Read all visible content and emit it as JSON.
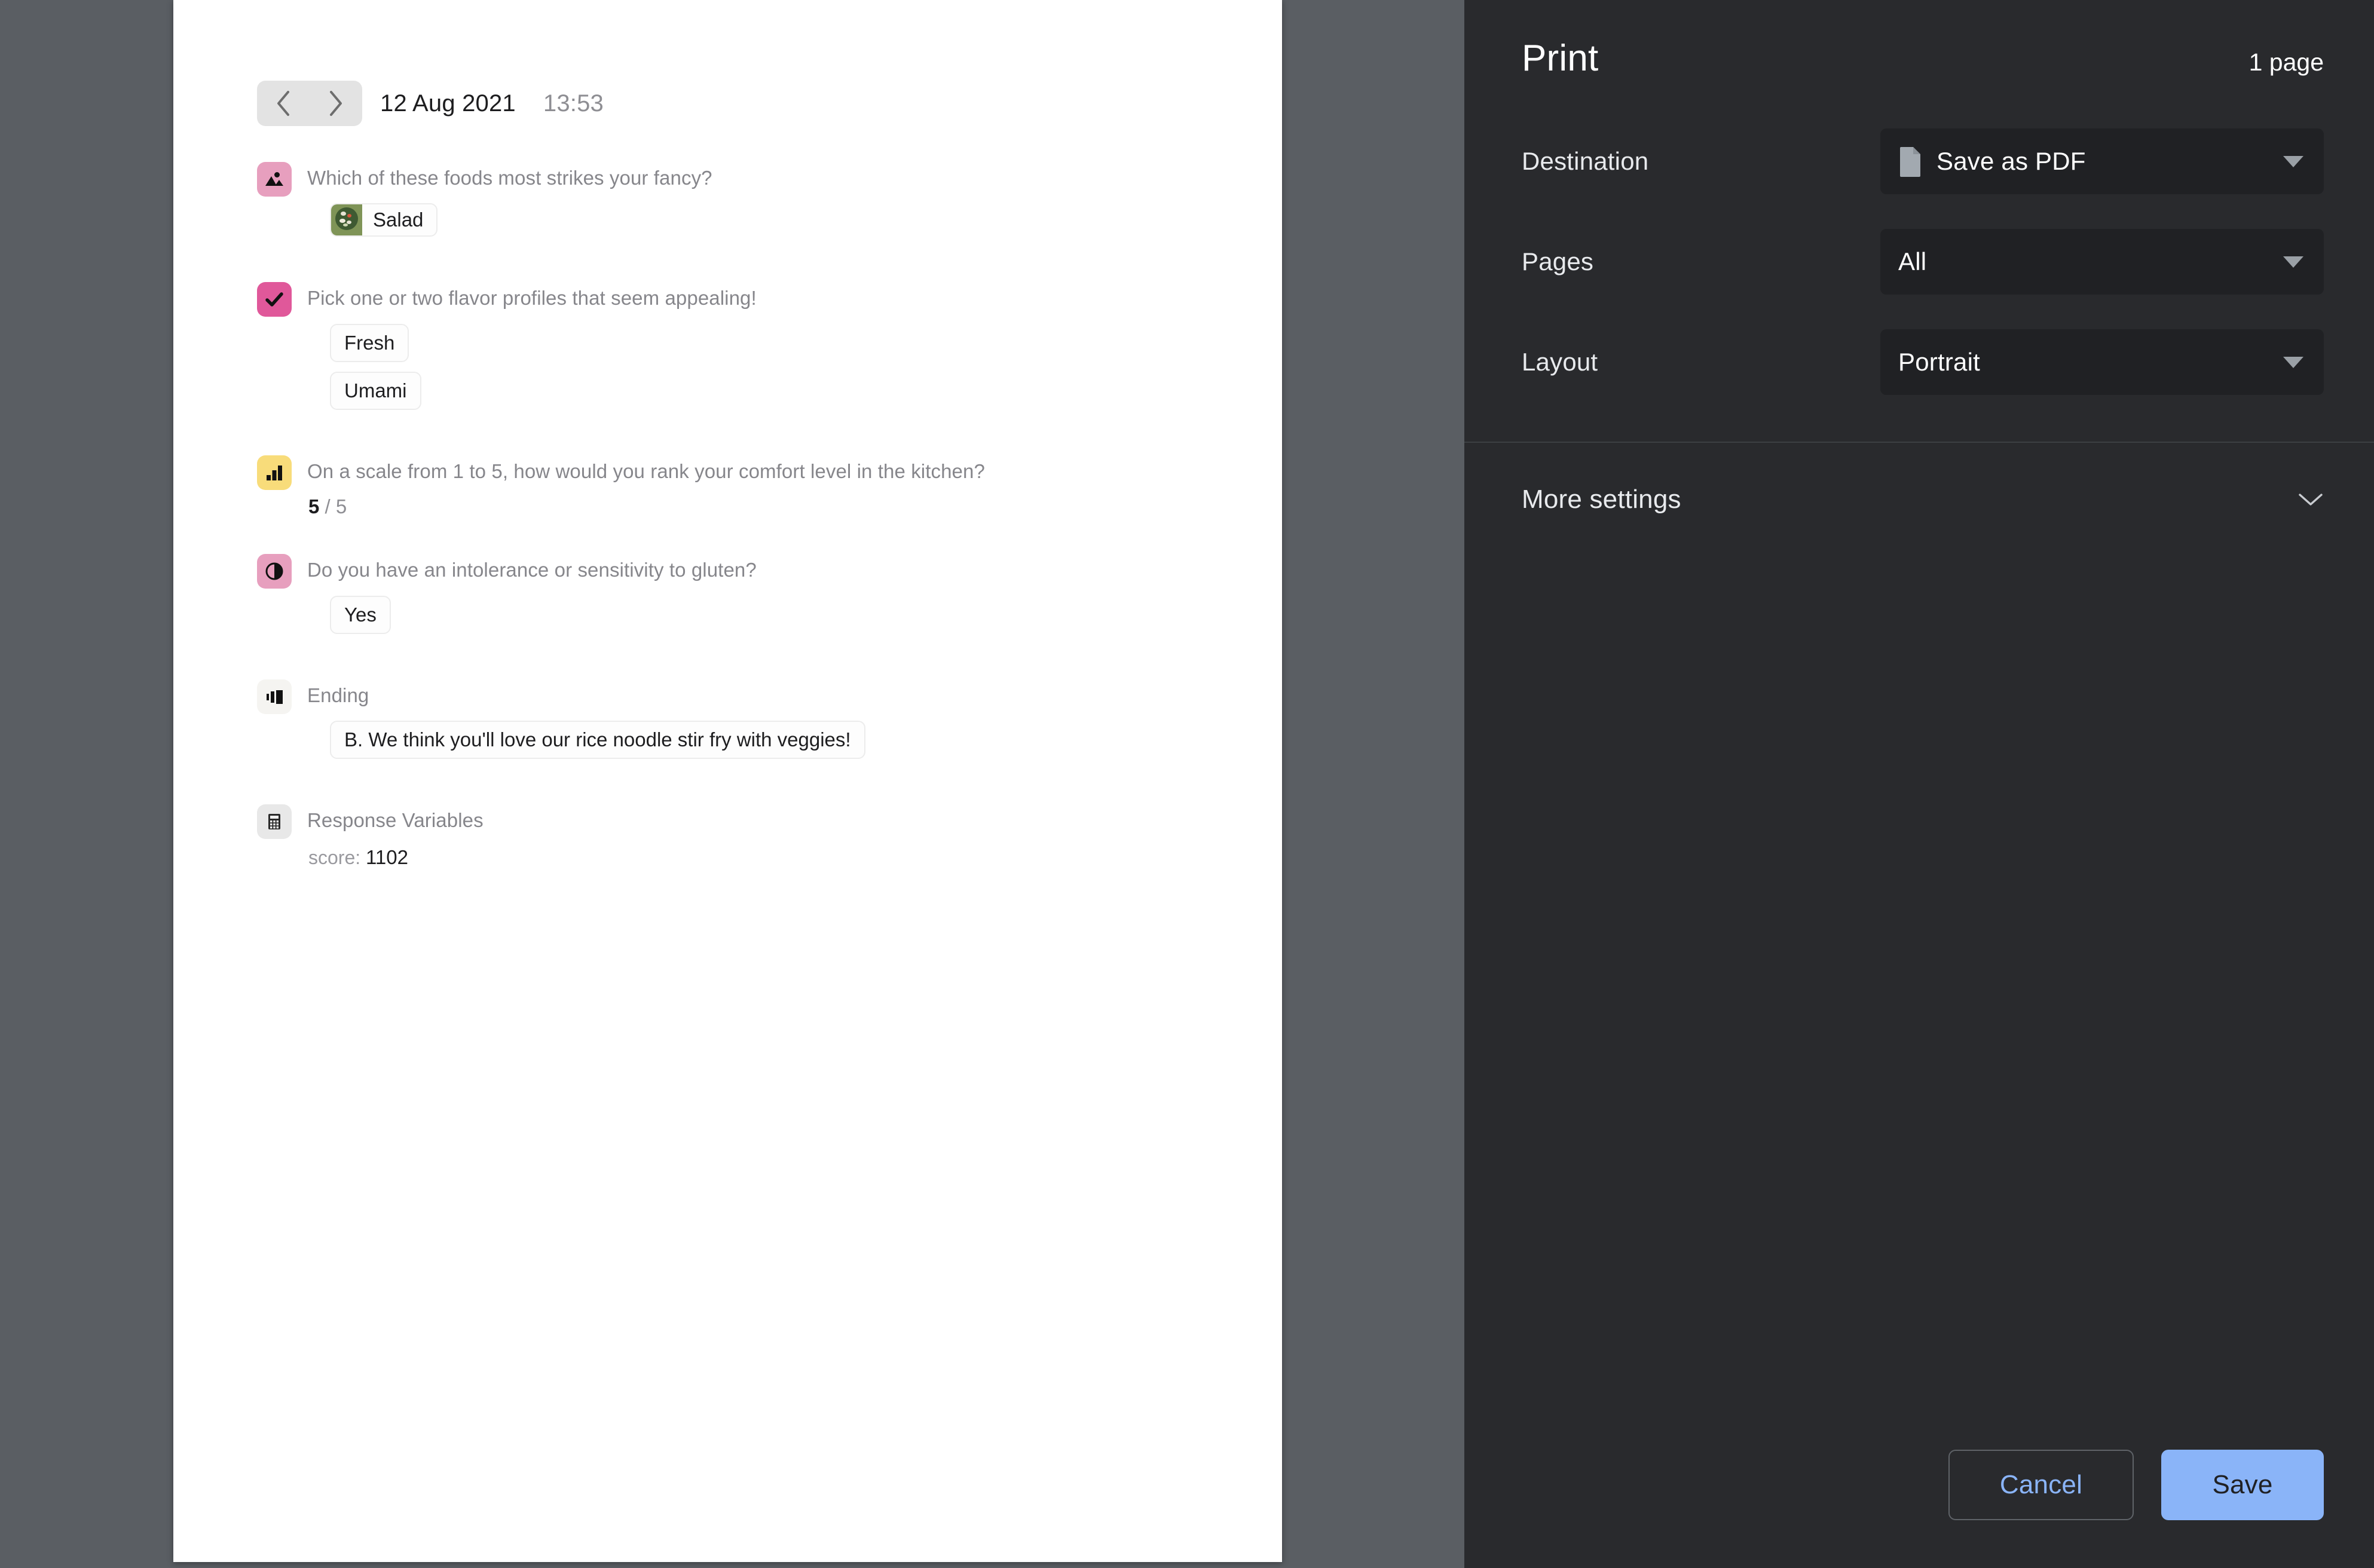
{
  "preview": {
    "nav": {
      "prev_icon": "chevron-left-icon",
      "next_icon": "chevron-right-icon"
    },
    "date": "12 Aug 2021",
    "time": "13:53",
    "blocks": [
      {
        "icon": "picture-icon",
        "icon_bg": "#e79fbe",
        "question": "Which of these foods most strikes your fancy?",
        "answers": [
          {
            "label": "Salad",
            "thumb": "salad-photo"
          }
        ]
      },
      {
        "icon": "checkmark-icon",
        "icon_bg": "#e0589a",
        "question": "Pick one or two flavor profiles that seem appealing!",
        "answers": [
          {
            "label": "Fresh"
          },
          {
            "label": "Umami"
          }
        ]
      },
      {
        "icon": "bar-chart-icon",
        "icon_bg": "#f8dc7a",
        "question": "On a scale from 1 to 5, how would you rank your comfort level in the kitchen?",
        "rating_value": "5",
        "rating_max": "/ 5"
      },
      {
        "icon": "yes-no-circle-icon",
        "icon_bg": "#e79fbe",
        "question": "Do you have an intolerance or sensitivity to gluten?",
        "answers": [
          {
            "label": "Yes"
          }
        ]
      },
      {
        "icon": "ending-icon",
        "icon_bg": "#f5f4f1",
        "question": "Ending",
        "answers": [
          {
            "label": "B. We think you'll love our rice noodle stir fry with veggies!"
          }
        ]
      },
      {
        "icon": "calculator-icon",
        "icon_bg": "#e8e8e8",
        "question": "Response Variables",
        "variable_name": "score:",
        "variable_value": "1102"
      }
    ]
  },
  "print_dialog": {
    "title": "Print",
    "page_count": "1 page",
    "rows": [
      {
        "label": "Destination",
        "value": "Save as PDF",
        "icon": "document-icon",
        "caret": "caret-down-icon"
      },
      {
        "label": "Pages",
        "value": "All",
        "caret": "caret-down-icon"
      },
      {
        "label": "Layout",
        "value": "Portrait",
        "caret": "caret-down-icon"
      }
    ],
    "more_settings": {
      "label": "More settings",
      "icon": "chevron-down-icon"
    },
    "buttons": {
      "cancel": "Cancel",
      "save": "Save"
    },
    "colors": {
      "panel_bg": "#292a2d",
      "select_bg": "#202124",
      "accent": "#8ab4f8",
      "preview_bg": "#5a5e63"
    }
  }
}
